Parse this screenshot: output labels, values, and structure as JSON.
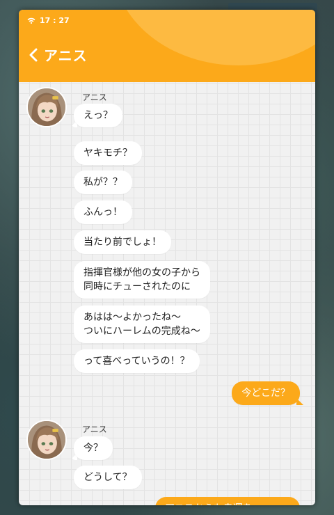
{
  "status_bar": {
    "time": "17 : 27",
    "wifi_icon": "wifi-icon"
  },
  "header": {
    "back_icon": "chevron-left-icon",
    "title": "アニス"
  },
  "colors": {
    "accent": "#fca91a",
    "incoming_bubble": "#ffffff",
    "panel_bg": "#f1f1f1"
  },
  "groups": [
    {
      "sender": "アニス",
      "messages": [
        "えっ？",
        "ヤキモチ？",
        "私が？？",
        "ふんっ！",
        "当たり前でしょ！",
        "指揮官様が他の女の子から\n同時にチューされたのに",
        "あはは～よかったね～\nついにハーレムの完成ね～",
        "って喜べっていうの！？"
      ]
    },
    {
      "outgoing": "今どこだ？"
    },
    {
      "sender": "アニス",
      "messages": [
        "今？",
        "どうして？"
      ]
    },
    {
      "outgoing": "アニスからも幸運を"
    }
  ]
}
